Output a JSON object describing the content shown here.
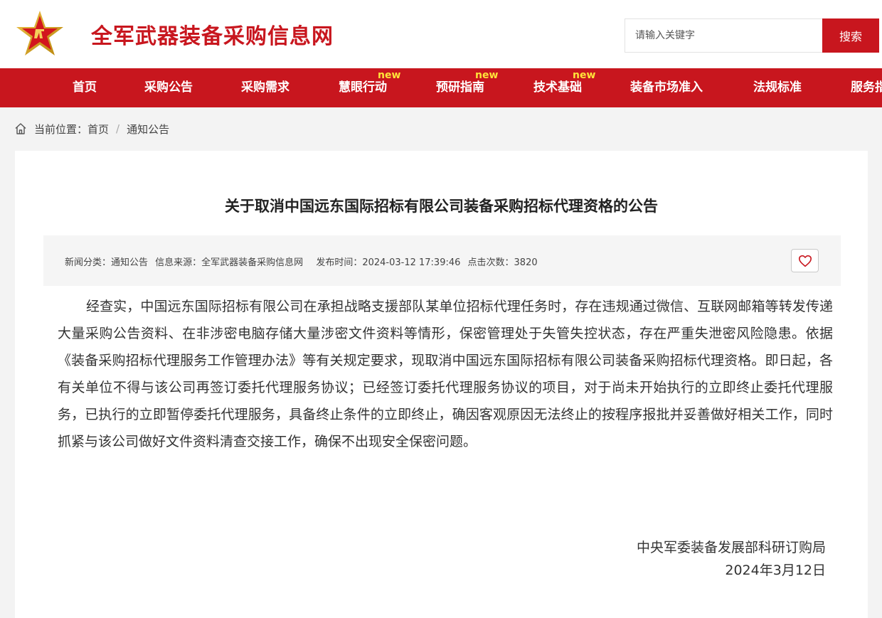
{
  "header": {
    "site_title": "全军武器装备采购信息网",
    "search_placeholder": "请输入关键字",
    "search_button": "搜索",
    "logo_icon": "pla-star-emblem-icon"
  },
  "nav": {
    "items": [
      {
        "label": "首页",
        "new": false
      },
      {
        "label": "采购公告",
        "new": false
      },
      {
        "label": "采购需求",
        "new": false
      },
      {
        "label": "慧眼行动",
        "new": true
      },
      {
        "label": "预研指南",
        "new": true
      },
      {
        "label": "技术基础",
        "new": true
      },
      {
        "label": "装备市场准入",
        "new": false
      },
      {
        "label": "法规标准",
        "new": false
      },
      {
        "label": "服务指",
        "new": false
      }
    ],
    "new_badge": "new"
  },
  "breadcrumb": {
    "prefix": "当前位置：",
    "home": "首页",
    "separator": "/",
    "current": "通知公告"
  },
  "article": {
    "title": "关于取消中国远东国际招标有限公司装备采购招标代理资格的公告",
    "meta": {
      "category": "新闻分类：通知公告",
      "source": "信息来源：全军武器装备采购信息网",
      "time": "发布时间：2024-03-12 17:39:46",
      "clicks": "点击次数：3820"
    },
    "body": "经查实，中国远东国际招标有限公司在承担战略支援部队某单位招标代理任务时，存在违规通过微信、互联网邮箱等转发传递大量采购公告资料、在非涉密电脑存储大量涉密文件资料等情形，保密管理处于失管失控状态，存在严重失泄密风险隐患。依据《装备采购招标代理服务工作管理办法》等有关规定要求，现取消中国远东国际招标有限公司装备采购招标代理资格。即日起，各有关单位不得与该公司再签订委托代理服务协议；已经签订委托代理服务协议的项目，对于尚未开始执行的立即终止委托代理服务，已执行的立即暂停委托代理服务，具备终止条件的立即终止，确因客观原因无法终止的按程序报批并妥善做好相关工作，同时抓紧与该公司做好文件资料清查交接工作，确保不出现安全保密问题。",
    "signature": "中央军委装备发展部科研订购局",
    "date": "2024年3月12日"
  },
  "colors": {
    "brand_red": "#c8161e",
    "new_badge": "#ffe43a"
  }
}
